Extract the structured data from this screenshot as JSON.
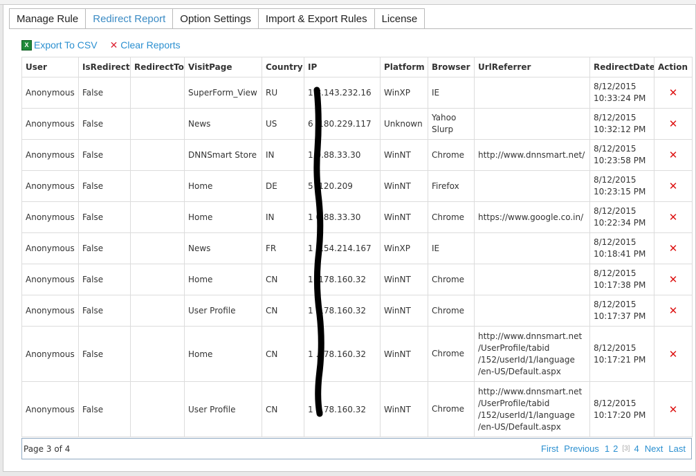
{
  "tabs": [
    {
      "label": "Manage Rule",
      "active": false
    },
    {
      "label": "Redirect Report",
      "active": true
    },
    {
      "label": "Option Settings",
      "active": false
    },
    {
      "label": "Import & Export Rules",
      "active": false
    },
    {
      "label": "License",
      "active": false
    }
  ],
  "toolbar": {
    "export_label": "Export To CSV",
    "clear_label": "Clear Reports"
  },
  "icons": {
    "export": "excel-icon",
    "clear": "close-icon",
    "delete": "delete-icon"
  },
  "colors": {
    "accent": "#3b8bc4",
    "link": "#2a8fd0",
    "delete": "#dd1111"
  },
  "columns": [
    "User",
    "IsRedirect",
    "RedirectTo",
    "VisitPage",
    "Country",
    "IP",
    "Platform",
    "Browser",
    "UrlReferrer",
    "RedirectDate",
    "Action"
  ],
  "rows": [
    {
      "user": "Anonymous",
      "is_redirect": "False",
      "redirect_to": "",
      "visit_page": "SuperForm_View",
      "country": "RU",
      "ip": "1 8.143.232.16",
      "platform": "WinXP",
      "browser": "IE",
      "referrer": "",
      "date": "8/12/2015 10:33:24 PM"
    },
    {
      "user": "Anonymous",
      "is_redirect": "False",
      "redirect_to": "",
      "visit_page": "News",
      "country": "US",
      "ip": "6 .180.229.117",
      "platform": "Unknown",
      "browser": "Yahoo Slurp",
      "referrer": "",
      "date": "8/12/2015 10:32:12 PM"
    },
    {
      "user": "Anonymous",
      "is_redirect": "False",
      "redirect_to": "",
      "visit_page": "DNNSmart Store",
      "country": "IN",
      "ip": "1 0.88.33.30",
      "platform": "WinNT",
      "browser": "Chrome",
      "referrer": "http://www.dnnsmart.net/",
      "date": "8/12/2015 10:23:58 PM"
    },
    {
      "user": "Anonymous",
      "is_redirect": "False",
      "redirect_to": "",
      "visit_page": "Home",
      "country": "DE",
      "ip": "5 .120.209",
      "platform": "WinNT",
      "browser": "Firefox",
      "referrer": "",
      "date": "8/12/2015 10:23:15 PM"
    },
    {
      "user": "Anonymous",
      "is_redirect": "False",
      "redirect_to": "",
      "visit_page": "Home",
      "country": "IN",
      "ip": "1 0.88.33.30",
      "platform": "WinNT",
      "browser": "Chrome",
      "referrer": "https://www.google.co.in/",
      "date": "8/12/2015 10:22:34 PM"
    },
    {
      "user": "Anonymous",
      "is_redirect": "False",
      "redirect_to": "",
      "visit_page": "News",
      "country": "FR",
      "ip": "1 .154.214.167",
      "platform": "WinXP",
      "browser": "IE",
      "referrer": "",
      "date": "8/12/2015 10:18:41 PM"
    },
    {
      "user": "Anonymous",
      "is_redirect": "False",
      "redirect_to": "",
      "visit_page": "Home",
      "country": "CN",
      "ip": "1 .178.160.32",
      "platform": "WinNT",
      "browser": "Chrome",
      "referrer": "",
      "date": "8/12/2015 10:17:38 PM"
    },
    {
      "user": "Anonymous",
      "is_redirect": "False",
      "redirect_to": "",
      "visit_page": "User Profile",
      "country": "CN",
      "ip": "1 .178.160.32",
      "platform": "WinNT",
      "browser": "Chrome",
      "referrer": "",
      "date": "8/12/2015 10:17:37 PM"
    },
    {
      "user": "Anonymous",
      "is_redirect": "False",
      "redirect_to": "",
      "visit_page": "Home",
      "country": "CN",
      "ip": "1 .178.160.32",
      "platform": "WinNT",
      "browser": "Chrome",
      "referrer": "http://www.dnnsmart.net /UserProfile/tabid /152/userId/1/language /en-US/Default.aspx",
      "date": "8/12/2015 10:17:21 PM"
    },
    {
      "user": "Anonymous",
      "is_redirect": "False",
      "redirect_to": "",
      "visit_page": "User Profile",
      "country": "CN",
      "ip": "1 .178.160.32",
      "platform": "WinNT",
      "browser": "Chrome",
      "referrer": "http://www.dnnsmart.net /UserProfile/tabid /152/userId/1/language /en-US/Default.aspx",
      "date": "8/12/2015 10:17:20 PM"
    }
  ],
  "pager": {
    "info": "Page 3 of 4",
    "first": "First",
    "previous": "Previous",
    "pages": [
      "1",
      "2",
      "[3]",
      "4"
    ],
    "next": "Next",
    "last": "Last"
  }
}
